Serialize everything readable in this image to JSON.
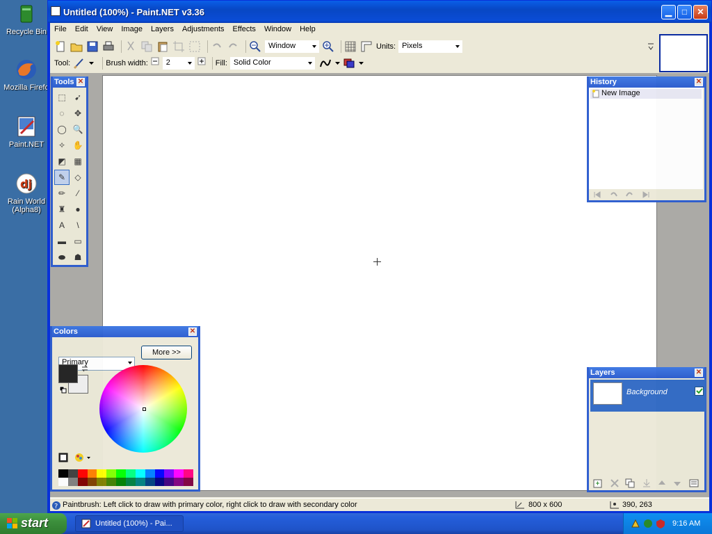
{
  "desktop": {
    "icons": [
      {
        "label": "Recycle Bin",
        "icon": "recycle-bin-icon"
      },
      {
        "label": "Mozilla Firefo",
        "icon": "firefox-icon"
      },
      {
        "label": "Paint.NET",
        "icon": "paintnet-icon"
      },
      {
        "label": "Rain World (Alpha8)",
        "icon": "rain-world-icon"
      }
    ]
  },
  "window": {
    "title": "Untitled (100%) - Paint.NET v3.36",
    "minimize_icon": "minimize-icon",
    "maximize_icon": "maximize-icon",
    "close_icon": "close-icon"
  },
  "menubar": [
    "File",
    "Edit",
    "View",
    "Image",
    "Layers",
    "Adjustments",
    "Effects",
    "Window",
    "Help"
  ],
  "toolbar": {
    "zoom_value": "Window",
    "units_label": "Units:",
    "units_value": "Pixels"
  },
  "toolbar2": {
    "tool_label": "Tool:",
    "brush_width_label": "Brush width:",
    "brush_width_value": "2",
    "fill_label": "Fill:",
    "fill_value": "Solid Color"
  },
  "tools_panel": {
    "title": "Tools",
    "tools": [
      "rectangle-select-icon",
      "move-selection-icon",
      "lasso-select-icon",
      "move-selected-icon",
      "ellipse-select-icon",
      "zoom-icon",
      "magic-wand-icon",
      "pan-icon",
      "paint-bucket-icon",
      "gradient-icon",
      "paintbrush-icon",
      "eraser-icon",
      "pencil-icon",
      "color-picker-icon",
      "clone-stamp-icon",
      "recolor-icon",
      "text-icon",
      "line-curve-icon",
      "rectangle-icon",
      "rounded-rectangle-icon",
      "ellipse-icon",
      "freeform-shape-icon"
    ],
    "active_index": 10
  },
  "history_panel": {
    "title": "History",
    "items": [
      "New Image"
    ]
  },
  "colors_panel": {
    "title": "Colors",
    "mode": "Primary",
    "more_button": "More >>",
    "primary_color": "#222222",
    "secondary_color": "#f0f0f0"
  },
  "layers_panel": {
    "title": "Layers",
    "layers": [
      {
        "name": "Background",
        "visible": true
      }
    ]
  },
  "status": {
    "hint": "Paintbrush: Left click to draw with primary color, right click to draw with secondary color",
    "image_size": "800 x 600",
    "cursor_pos": "390, 263"
  },
  "taskbar": {
    "start_label": "start",
    "task_label": "Untitled (100%) - Pai...",
    "clock": "9:16 AM"
  },
  "palette_colors": [
    "#000000",
    "#404040",
    "#ff0000",
    "#ff8000",
    "#ffff00",
    "#80ff00",
    "#00ff00",
    "#00ff80",
    "#00ffff",
    "#0080ff",
    "#0000ff",
    "#8000ff",
    "#ff00ff",
    "#ff0080",
    "#ffffff",
    "#808080",
    "#800000",
    "#804000",
    "#808000",
    "#408000",
    "#008000",
    "#008040",
    "#008080",
    "#004080",
    "#000080",
    "#400080",
    "#800080",
    "#800040"
  ]
}
